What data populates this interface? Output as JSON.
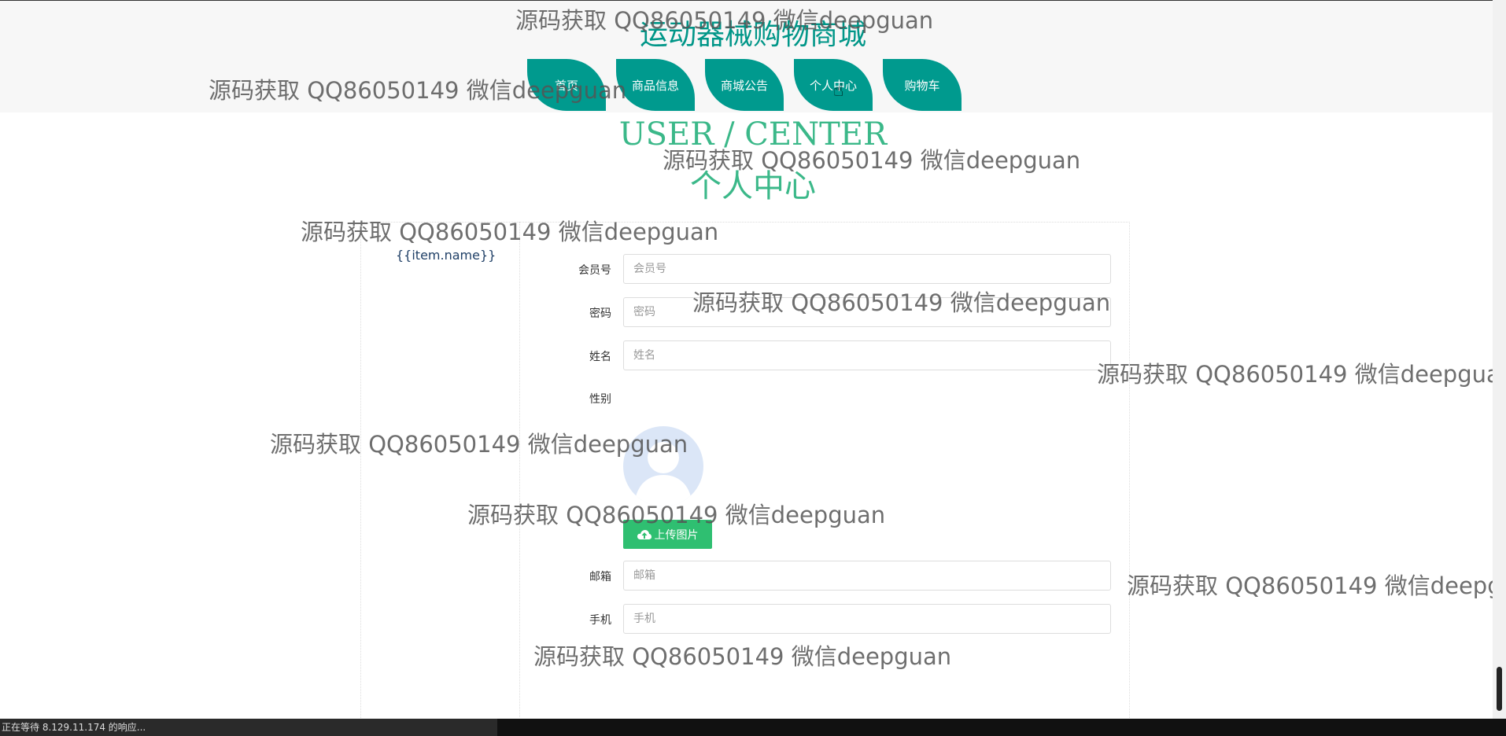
{
  "header": {
    "site_title": "运动器械购物商城",
    "nav": [
      "首页",
      "商品信息",
      "商城公告",
      "个人中心",
      "购物车"
    ]
  },
  "page": {
    "title_en": "USER / CENTER",
    "title_cn": "个人中心"
  },
  "side_menu": {
    "template_text": "{{item.name}}"
  },
  "form": {
    "member_no": {
      "label": "会员号",
      "placeholder": "会员号",
      "value": ""
    },
    "password": {
      "label": "密码",
      "placeholder": "密码",
      "value": ""
    },
    "name": {
      "label": "姓名",
      "placeholder": "姓名",
      "value": ""
    },
    "gender": {
      "label": "性别"
    },
    "upload_label": "上传图片",
    "email": {
      "label": "邮箱",
      "placeholder": "邮箱",
      "value": ""
    },
    "phone": {
      "label": "手机",
      "placeholder": "手机",
      "value": ""
    }
  },
  "watermark": "源码获取 QQ86050149 微信deepguan",
  "status_bar": "正在等待 8.129.11.174 的响应...",
  "colors": {
    "accent": "#009688",
    "title_green": "#3bb889",
    "upload": "#2fbf71"
  }
}
